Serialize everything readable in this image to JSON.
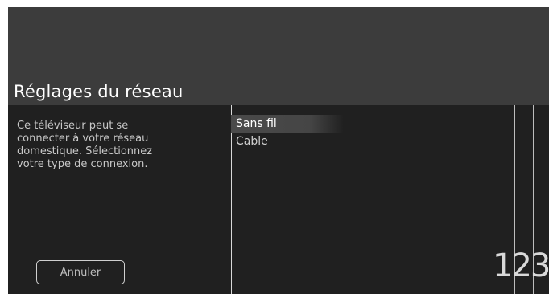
{
  "header": {
    "title": "Réglages du réseau"
  },
  "left_panel": {
    "description": "Ce téléviseur peut se\nconnecter à votre réseau\ndomestique. Sélectionnez\nvotre type de connexion.",
    "cancel_label": "Annuler"
  },
  "options": [
    {
      "label": "Sans fil",
      "selected": true
    },
    {
      "label": "Cable",
      "selected": false
    }
  ],
  "page_number": "123",
  "colors": {
    "background": "#202020",
    "header": "#3c3c3c",
    "text": "#ffffff",
    "secondary_text": "#c8c8c8"
  }
}
